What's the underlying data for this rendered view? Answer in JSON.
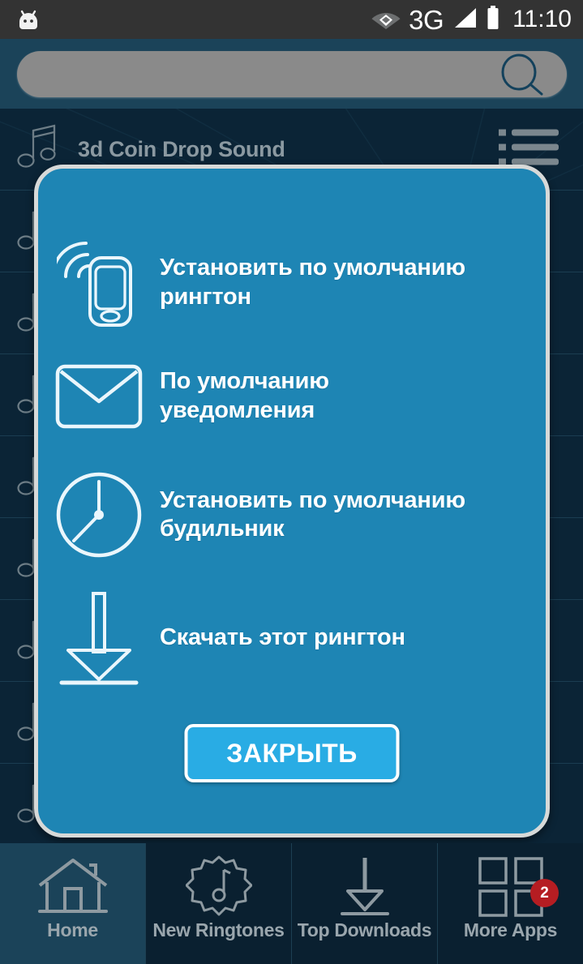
{
  "status_bar": {
    "left_icon": "android-head-icon",
    "network_type": "3G",
    "time": "11:10",
    "icons": [
      "wifi-icon",
      "signal-icon",
      "battery-icon"
    ],
    "background_color": "#333333"
  },
  "search": {
    "value": "",
    "placeholder": "",
    "icon": "search-icon",
    "field_color": "#8a8a8a",
    "header_color": "#1b4359"
  },
  "background": {
    "list_rows": [
      {
        "title": "3d Coin Drop Sound",
        "icon": "music-note-icon",
        "menu_icon": "list-menu-icon"
      },
      {
        "title": "",
        "icon": "music-note-icon",
        "menu_icon": "list-menu-icon"
      },
      {
        "title": "",
        "icon": "music-note-icon",
        "menu_icon": "list-menu-icon"
      },
      {
        "title": "",
        "icon": "music-note-icon",
        "menu_icon": "list-menu-icon"
      },
      {
        "title": "",
        "icon": "music-note-icon",
        "menu_icon": "list-menu-icon"
      },
      {
        "title": "",
        "icon": "music-note-icon",
        "menu_icon": "list-menu-icon"
      },
      {
        "title": "",
        "icon": "music-note-icon",
        "menu_icon": "list-menu-icon"
      },
      {
        "title": "",
        "icon": "music-note-icon",
        "menu_icon": "list-menu-icon"
      },
      {
        "title": "",
        "icon": "music-note-icon",
        "menu_icon": "list-menu-icon"
      }
    ],
    "color": "#0b2436"
  },
  "dialog": {
    "background_color": "#1e85b4",
    "border_color": "#d7d9d8",
    "options": [
      {
        "label": "Установить по умолчанию рингтон",
        "icon": "phone-ringing-icon"
      },
      {
        "label": "По умолчанию уведомления",
        "icon": "envelope-icon"
      },
      {
        "label": "Установить по умолчанию будильник",
        "icon": "clock-icon"
      },
      {
        "label": "Скачать этот рингтон",
        "icon": "download-arrow-icon"
      }
    ],
    "close_button": {
      "label": "ЗАКРЫТЬ",
      "background_color": "#29ace4",
      "border_color": "#ffffff"
    }
  },
  "bottom_nav": {
    "items": [
      {
        "label": "Home",
        "icon": "home-icon",
        "active": true,
        "badge": ""
      },
      {
        "label": "New Ringtones",
        "icon": "ringtone-star-icon",
        "active": false,
        "badge": ""
      },
      {
        "label": "Top Downloads",
        "icon": "download-arrow-icon",
        "active": false,
        "badge": ""
      },
      {
        "label": "More Apps",
        "icon": "grid-apps-icon",
        "active": false,
        "badge": "2"
      }
    ],
    "badge_color": "#b51d22",
    "active_color": "#1b4359"
  }
}
